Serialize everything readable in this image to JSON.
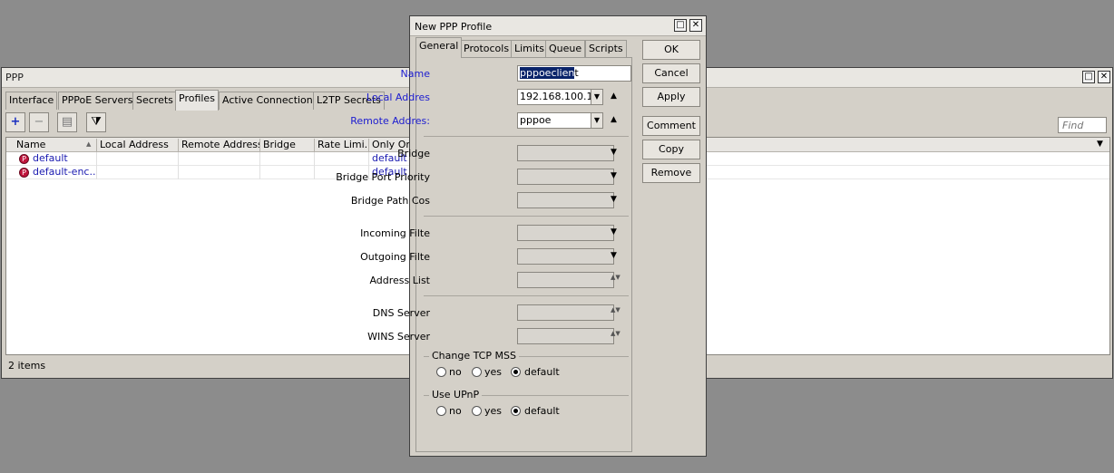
{
  "ppp_window": {
    "title": "PPP",
    "tabs": [
      "Interface",
      "PPPoE Servers",
      "Secrets",
      "Profiles",
      "Active Connections",
      "L2TP Secrets"
    ],
    "active_tab": "Profiles",
    "find_placeholder": "Find",
    "columns": [
      "Name",
      "Local Address",
      "Remote Address",
      "Bridge",
      "Rate Limi...",
      "Only One"
    ],
    "rows": [
      {
        "name": "default",
        "only_one": "default"
      },
      {
        "name": "default-enc...",
        "only_one": "default"
      }
    ],
    "status": "2 items",
    "restore_glyph": "□",
    "close_glyph": "✕"
  },
  "dialog": {
    "title": "New PPP Profile",
    "tabs": [
      "General",
      "Protocols",
      "Limits",
      "Queue",
      "Scripts"
    ],
    "active_tab": "General",
    "fields": {
      "name": {
        "label": "Name",
        "value_selected": "pppoeclien",
        "value_rest": "t"
      },
      "local_address": {
        "label": "Local Addres",
        "value": "192.168.100.1"
      },
      "remote_address": {
        "label": "Remote Addres:",
        "value": "pppoe"
      },
      "bridge": {
        "label": "Bridge"
      },
      "bridge_port_priority": {
        "label": "Bridge Port Priority"
      },
      "bridge_path_cost": {
        "label": "Bridge Path Cos"
      },
      "incoming_filter": {
        "label": "Incoming Filte"
      },
      "outgoing_filter": {
        "label": "Outgoing Filte"
      },
      "address_list": {
        "label": "Address List"
      },
      "dns_server": {
        "label": "DNS Server"
      },
      "wins_server": {
        "label": "WINS Server"
      }
    },
    "change_tcp_mss": {
      "label": "Change TCP MSS",
      "options": [
        "no",
        "yes",
        "default"
      ],
      "selected": "default"
    },
    "use_upnp": {
      "label": "Use UPnP",
      "options": [
        "no",
        "yes",
        "default"
      ],
      "selected": "default"
    },
    "buttons": {
      "ok": "OK",
      "cancel": "Cancel",
      "apply": "Apply",
      "comment": "Comment",
      "copy": "Copy",
      "remove": "Remove"
    }
  },
  "icons": {
    "add": "+",
    "remove": "−",
    "note": "▤",
    "filter": "⧩",
    "dropdown": "▼",
    "up": "▲",
    "updown": "▲▼"
  }
}
